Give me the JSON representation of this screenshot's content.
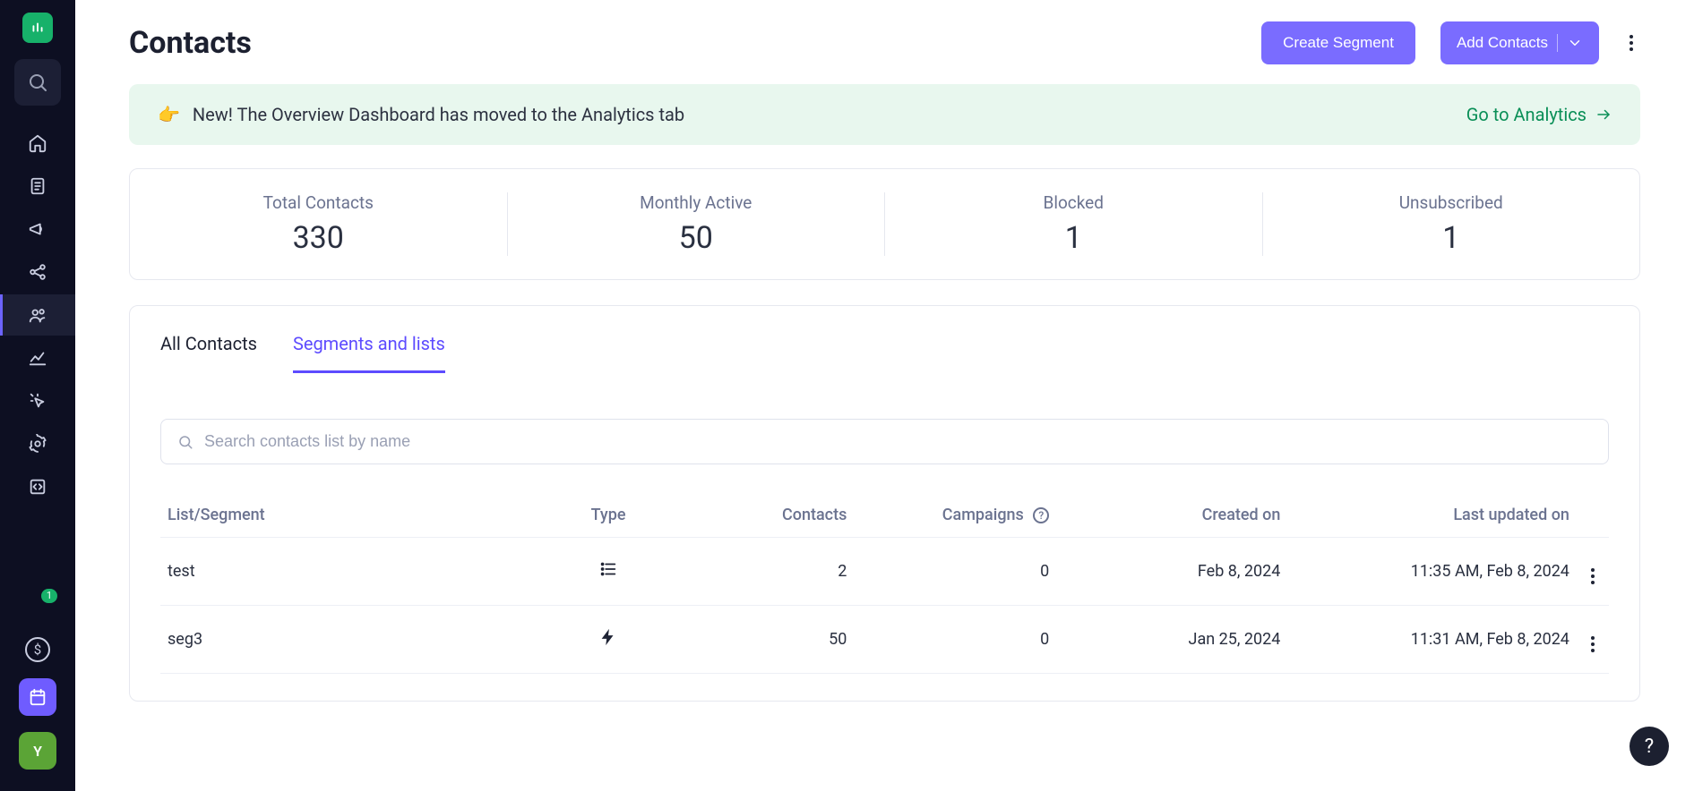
{
  "header": {
    "title": "Contacts",
    "create_segment_label": "Create Segment",
    "add_contacts_label": "Add Contacts"
  },
  "banner": {
    "emoji": "👉",
    "text": "New! The Overview Dashboard has moved to the Analytics tab",
    "cta_label": "Go to Analytics"
  },
  "stats": {
    "total_contacts": {
      "label": "Total Contacts",
      "value": "330"
    },
    "monthly_active": {
      "label": "Monthly Active",
      "value": "50"
    },
    "blocked": {
      "label": "Blocked",
      "value": "1"
    },
    "unsubscribed": {
      "label": "Unsubscribed",
      "value": "1"
    }
  },
  "tabs": {
    "all_contacts": "All Contacts",
    "segments_lists": "Segments and lists"
  },
  "search": {
    "placeholder": "Search contacts list by name"
  },
  "table": {
    "headers": {
      "list_segment": "List/Segment",
      "type": "Type",
      "contacts": "Contacts",
      "campaigns": "Campaigns",
      "created_on": "Created on",
      "last_updated_on": "Last updated on"
    },
    "rows": [
      {
        "name": "test",
        "type_icon": "list",
        "contacts": "2",
        "campaigns": "0",
        "created_on": "Feb 8, 2024",
        "last_updated_on": "11:35 AM, Feb 8, 2024"
      },
      {
        "name": "seg3",
        "type_icon": "bolt",
        "contacts": "50",
        "campaigns": "0",
        "created_on": "Jan 25, 2024",
        "last_updated_on": "11:31 AM, Feb 8, 2024"
      }
    ]
  },
  "sidebar": {
    "badge_count": "1",
    "avatar_letter": "Y"
  },
  "colors": {
    "accent": "#7a6cff",
    "success": "#0a8f57"
  }
}
